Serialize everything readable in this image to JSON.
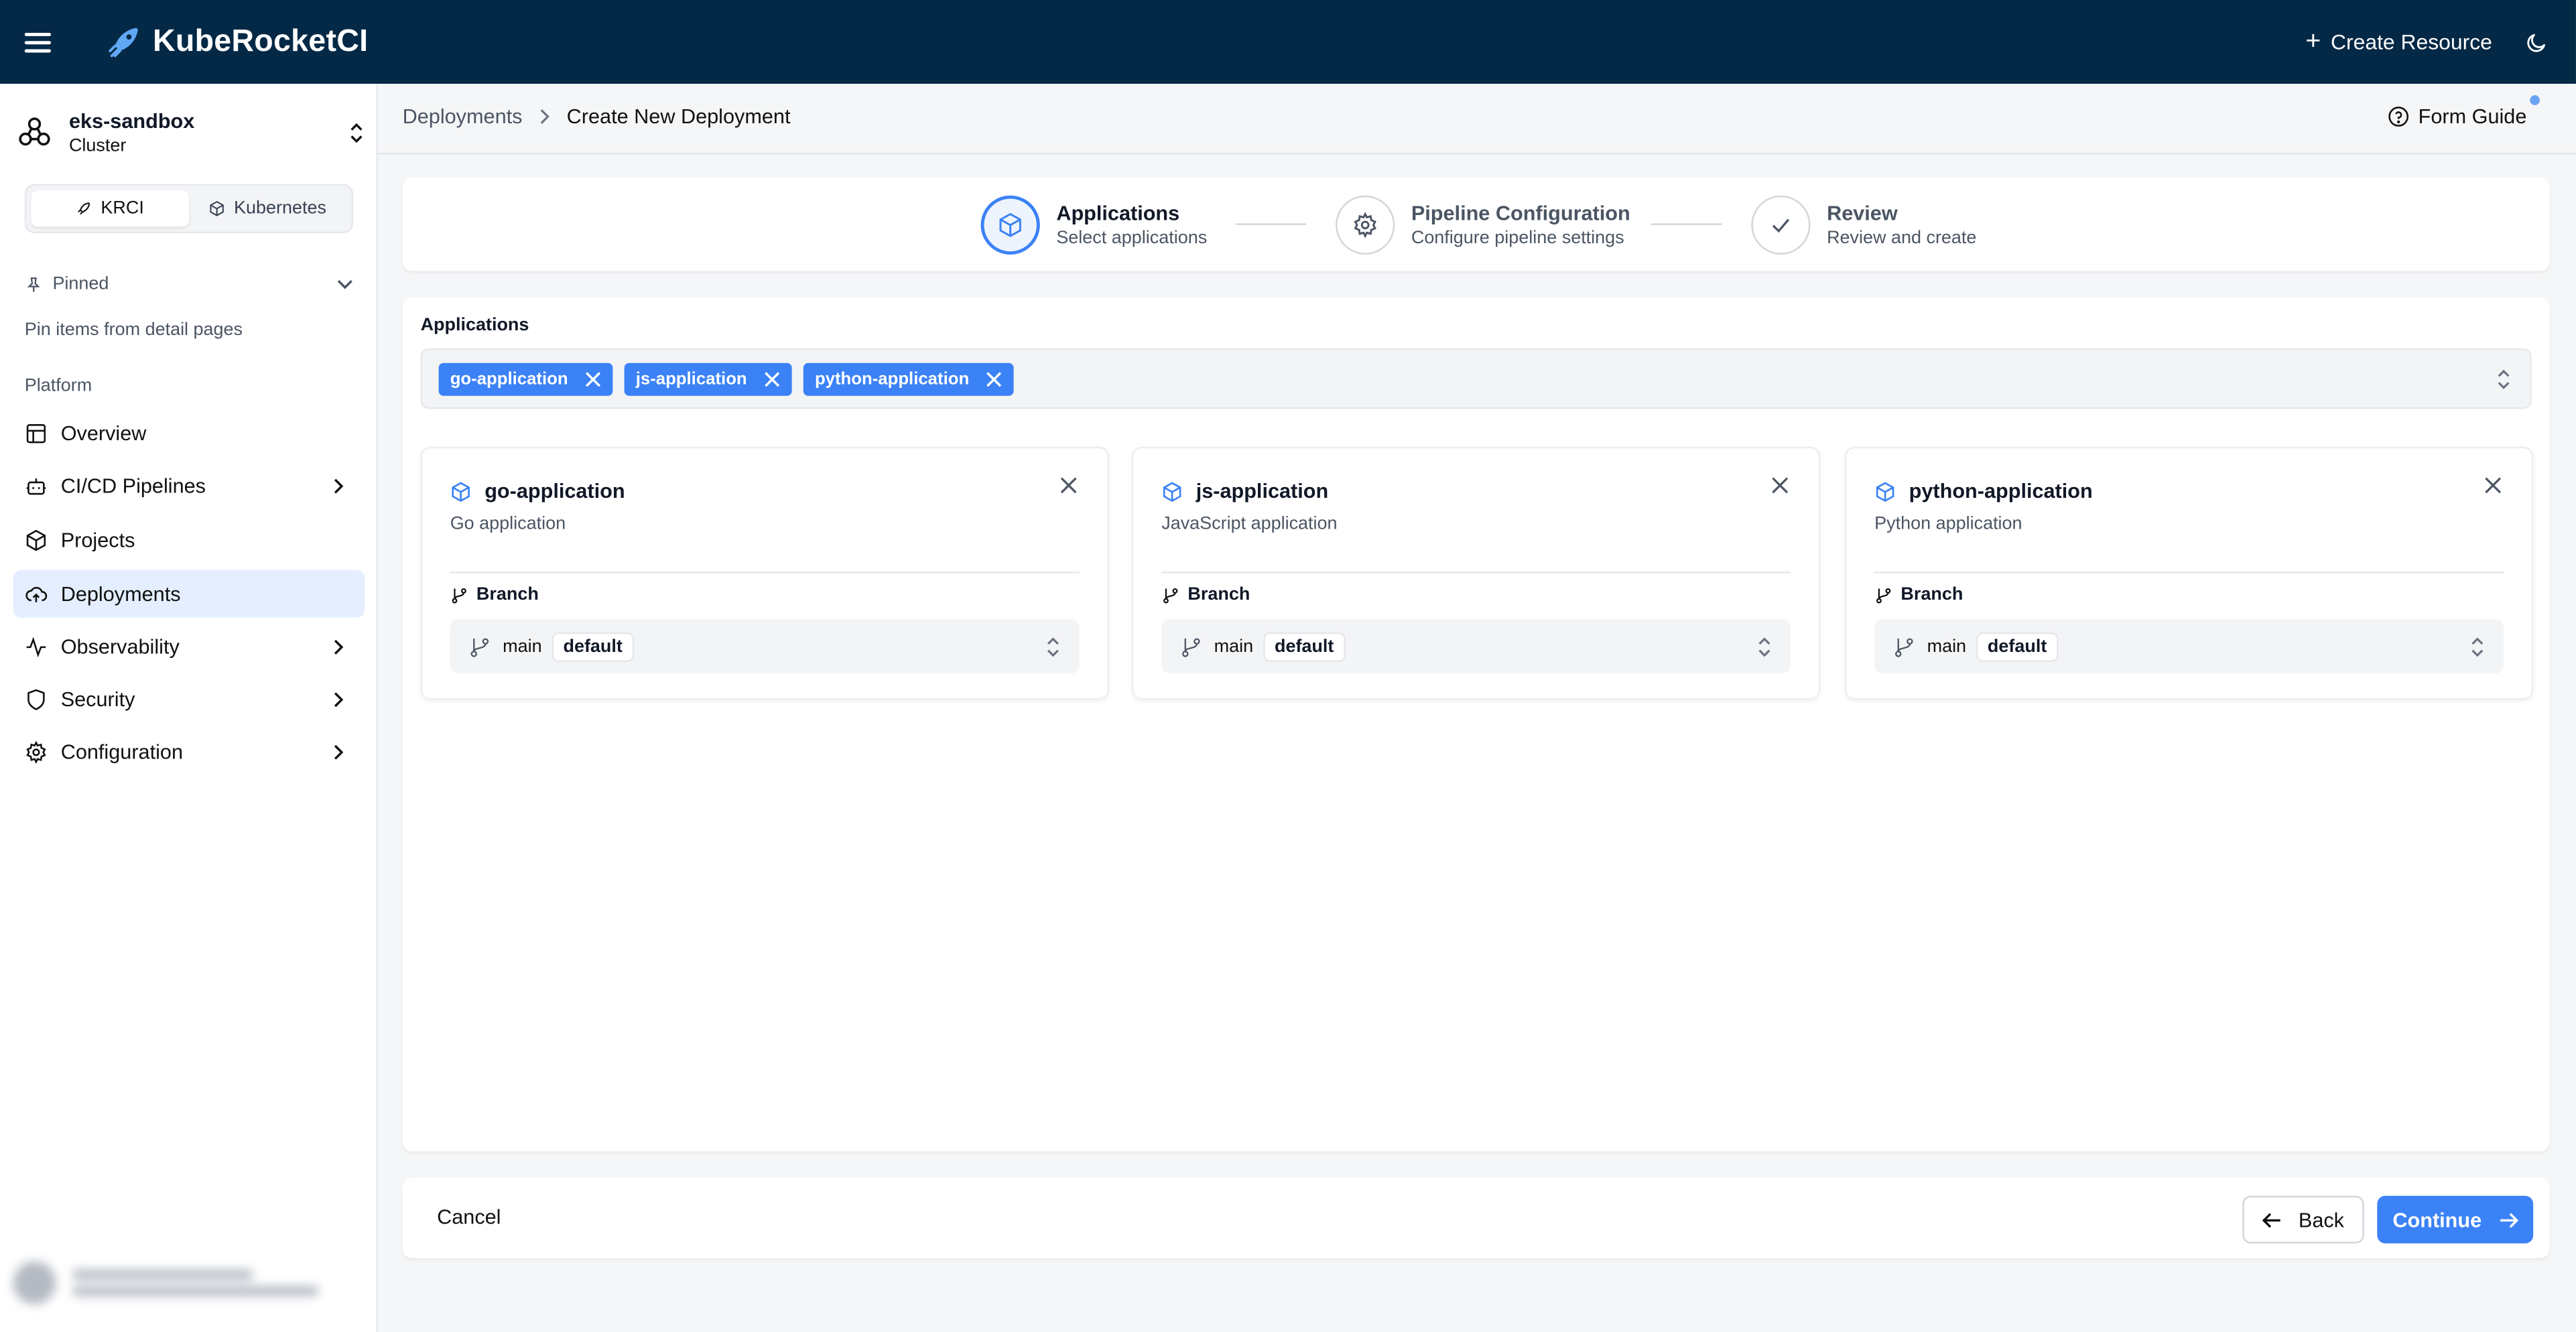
{
  "topbar": {
    "menu_icon": "hamburger-icon",
    "brand": "KubeRocketCI",
    "create_resource": "Create Resource",
    "theme_icon": "moon-icon"
  },
  "sidebar": {
    "cluster_name": "eks-sandbox",
    "cluster_type": "Cluster",
    "switch": [
      "KRCI",
      "Kubernetes"
    ],
    "pinned_label": "Pinned",
    "pinned_hint": "Pin items from detail pages",
    "section_label": "Platform",
    "items": [
      {
        "label": "Overview",
        "icon": "layout-icon",
        "expandable": false
      },
      {
        "label": "CI/CD Pipelines",
        "icon": "bot-icon",
        "expandable": true
      },
      {
        "label": "Projects",
        "icon": "box-icon",
        "expandable": false
      },
      {
        "label": "Deployments",
        "icon": "cloud-upload-icon",
        "expandable": false,
        "active": true
      },
      {
        "label": "Observability",
        "icon": "activity-icon",
        "expandable": true
      },
      {
        "label": "Security",
        "icon": "shield-icon",
        "expandable": true
      },
      {
        "label": "Configuration",
        "icon": "gear-icon",
        "expandable": true
      }
    ]
  },
  "breadcrumb": {
    "parent": "Deployments",
    "current": "Create New Deployment"
  },
  "form_guide": "Form Guide",
  "stepper": [
    {
      "title": "Applications",
      "subtitle": "Select applications",
      "active": true
    },
    {
      "title": "Pipeline Configuration",
      "subtitle": "Configure pipeline settings",
      "active": false
    },
    {
      "title": "Review",
      "subtitle": "Review and create",
      "active": false
    }
  ],
  "applications": {
    "label": "Applications",
    "selected": [
      "go-application",
      "js-application",
      "python-application"
    ],
    "cards": [
      {
        "name": "go-application",
        "description": "Go application",
        "branch_label": "Branch",
        "branch": "main",
        "badge": "default"
      },
      {
        "name": "js-application",
        "description": "JavaScript application",
        "branch_label": "Branch",
        "branch": "main",
        "badge": "default"
      },
      {
        "name": "python-application",
        "description": "Python application",
        "branch_label": "Branch",
        "branch": "main",
        "badge": "default"
      }
    ]
  },
  "footer": {
    "cancel": "Cancel",
    "back": "Back",
    "continue": "Continue"
  },
  "colors": {
    "topbar": "#042946",
    "accent": "#3b82f6",
    "active_nav": "#e4eefe"
  }
}
